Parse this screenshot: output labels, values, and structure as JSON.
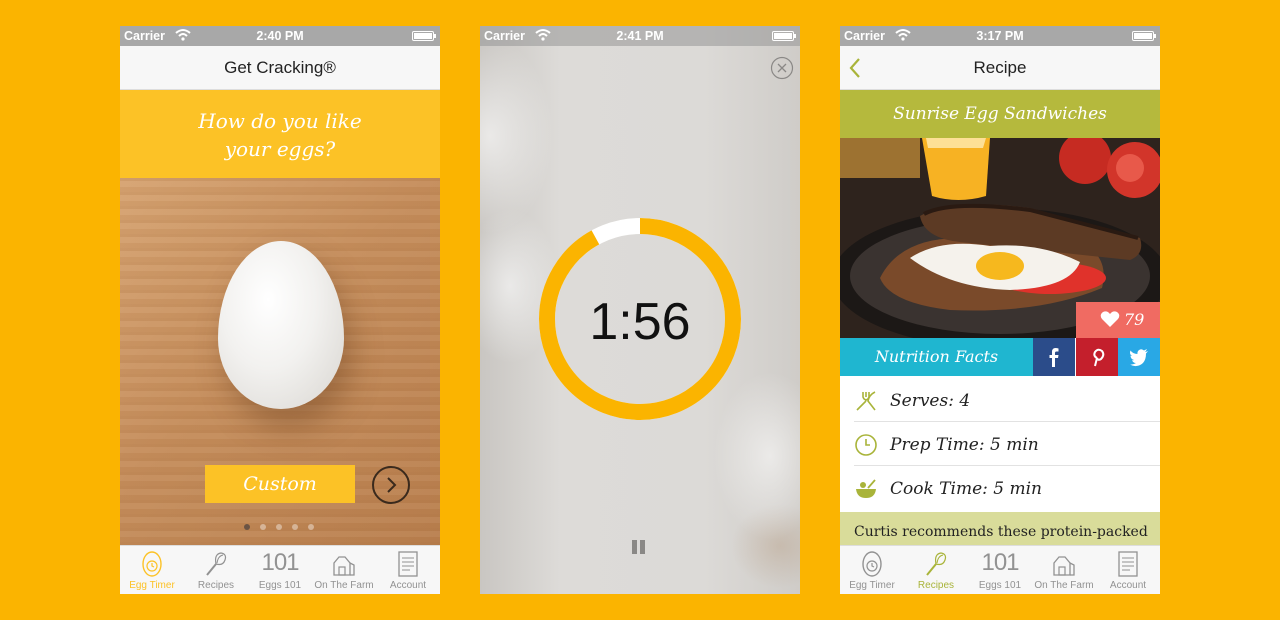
{
  "status": {
    "carrier": "Carrier",
    "time1": "2:40 PM",
    "time2": "2:41 PM",
    "time3": "3:17 PM"
  },
  "screen1": {
    "nav_title": "Get Cracking®",
    "question": [
      "How do you like",
      "your eggs?"
    ],
    "custom_button": "Custom",
    "page_dots": {
      "count": 5,
      "active": 1
    }
  },
  "screen2": {
    "timer": "1:56",
    "progress_fraction": 0.92
  },
  "screen3": {
    "nav_title": "Recipe",
    "recipe_title": "Sunrise Egg Sandwiches",
    "likes": "79",
    "nutrition_button": "Nutrition Facts",
    "serves": "Serves: 4",
    "prep_time": "Prep Time:  5 min",
    "cook_time": "Cook Time: 5 min",
    "recommendation": "Curtis recommends these protein-packed"
  },
  "tabs": [
    {
      "label": "Egg Timer",
      "icon": "egg-timer-icon"
    },
    {
      "label": "Recipes",
      "icon": "whisk-icon"
    },
    {
      "label": "Eggs 101",
      "icon": "eggs-101-icon",
      "number": "101"
    },
    {
      "label": "On The Farm",
      "icon": "barn-icon"
    },
    {
      "label": "Account",
      "icon": "account-icon"
    }
  ],
  "colors": {
    "background": "#fbb400",
    "egg_yellow": "#fcc226",
    "recipe_green": "#b5b93d",
    "nutrition_blue": "#1fb6d0",
    "like_red": "#f06b62",
    "facebook": "#2b4c8a",
    "pinterest": "#c41f2c",
    "twitter": "#29a8e5"
  }
}
